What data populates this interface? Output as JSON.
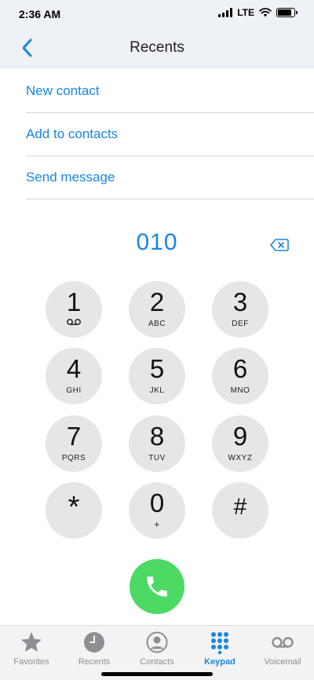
{
  "status_bar": {
    "time": "2:36 AM",
    "network": "LTE",
    "icons": [
      "signal-icon",
      "wifi-icon",
      "battery-icon"
    ]
  },
  "nav": {
    "title": "Recents",
    "back_icon": "chevron-left-icon"
  },
  "actions": [
    {
      "label": "New contact"
    },
    {
      "label": "Add to contacts"
    },
    {
      "label": "Send message"
    }
  ],
  "dialer": {
    "number": "010",
    "backspace_icon": "backspace-icon"
  },
  "keypad": [
    {
      "digit": "1",
      "letters": ""
    },
    {
      "digit": "2",
      "letters": "ABC"
    },
    {
      "digit": "3",
      "letters": "DEF"
    },
    {
      "digit": "4",
      "letters": "GHI"
    },
    {
      "digit": "5",
      "letters": "JKL"
    },
    {
      "digit": "6",
      "letters": "MNO"
    },
    {
      "digit": "7",
      "letters": "PQRS"
    },
    {
      "digit": "8",
      "letters": "TUV"
    },
    {
      "digit": "9",
      "letters": "WXYZ"
    },
    {
      "digit": "*",
      "letters": ""
    },
    {
      "digit": "0",
      "letters": "+"
    },
    {
      "digit": "#",
      "letters": ""
    }
  ],
  "call_icon": "phone-icon",
  "tabs": [
    {
      "label": "Favorites",
      "icon": "star-icon",
      "active": false
    },
    {
      "label": "Recents",
      "icon": "clock-icon",
      "active": false
    },
    {
      "label": "Contacts",
      "icon": "person-circle-icon",
      "active": false
    },
    {
      "label": "Keypad",
      "icon": "keypad-grid-icon",
      "active": true
    },
    {
      "label": "Voicemail",
      "icon": "voicemail-icon",
      "active": false
    }
  ],
  "colors": {
    "accent": "#1a86e0",
    "call_green": "#4cd964",
    "key_bg": "#e6e6e6",
    "inactive_tab": "#8e8e93"
  }
}
